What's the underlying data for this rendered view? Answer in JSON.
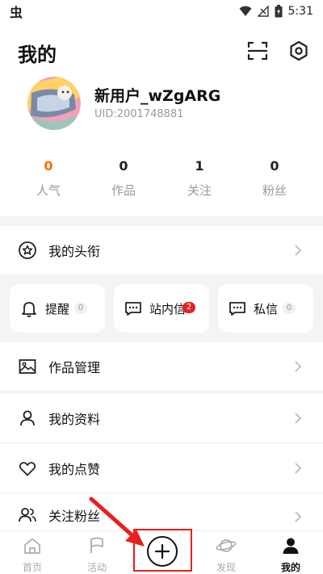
{
  "status_bar": {
    "left_glyph": "虫",
    "time": "5:31",
    "icons": [
      "wifi-icon",
      "signal-icon",
      "battery-icon"
    ]
  },
  "header": {
    "title": "我的",
    "icons": [
      "scan-icon",
      "settings-icon"
    ]
  },
  "profile": {
    "username": "新用户_wZgARG",
    "uid": "UID:2001748881"
  },
  "stats": [
    {
      "value": "0",
      "label": "人气",
      "highlight": true
    },
    {
      "value": "0",
      "label": "作品"
    },
    {
      "value": "1",
      "label": "关注"
    },
    {
      "value": "0",
      "label": "粉丝"
    }
  ],
  "title_item": {
    "label": "我的头衔"
  },
  "messages": [
    {
      "label": "提醒",
      "count": "0",
      "icon": "bell-icon"
    },
    {
      "label": "站内信",
      "count": "2",
      "icon": "chat-icon",
      "unread": true
    },
    {
      "label": "私信",
      "count": "0",
      "icon": "chat-icon"
    }
  ],
  "menu": [
    {
      "label": "作品管理",
      "icon": "image-icon"
    },
    {
      "label": "我的资料",
      "icon": "user-icon"
    },
    {
      "label": "我的点赞",
      "icon": "heart-icon"
    },
    {
      "label": "关注粉丝",
      "icon": "users-icon"
    }
  ],
  "tabbar": {
    "tabs": [
      {
        "label": "首页",
        "icon": "home-icon"
      },
      {
        "label": "活动",
        "icon": "flag-icon"
      },
      {
        "label": "",
        "icon": "plus-icon"
      },
      {
        "label": "发现",
        "icon": "planet-icon"
      },
      {
        "label": "我的",
        "icon": "person-icon",
        "active": true
      }
    ]
  },
  "colors": {
    "accent": "#ff6a00",
    "badge_red": "#e8202a",
    "annotation_red": "#e6201e",
    "background_gray": "#f4f4f4"
  }
}
